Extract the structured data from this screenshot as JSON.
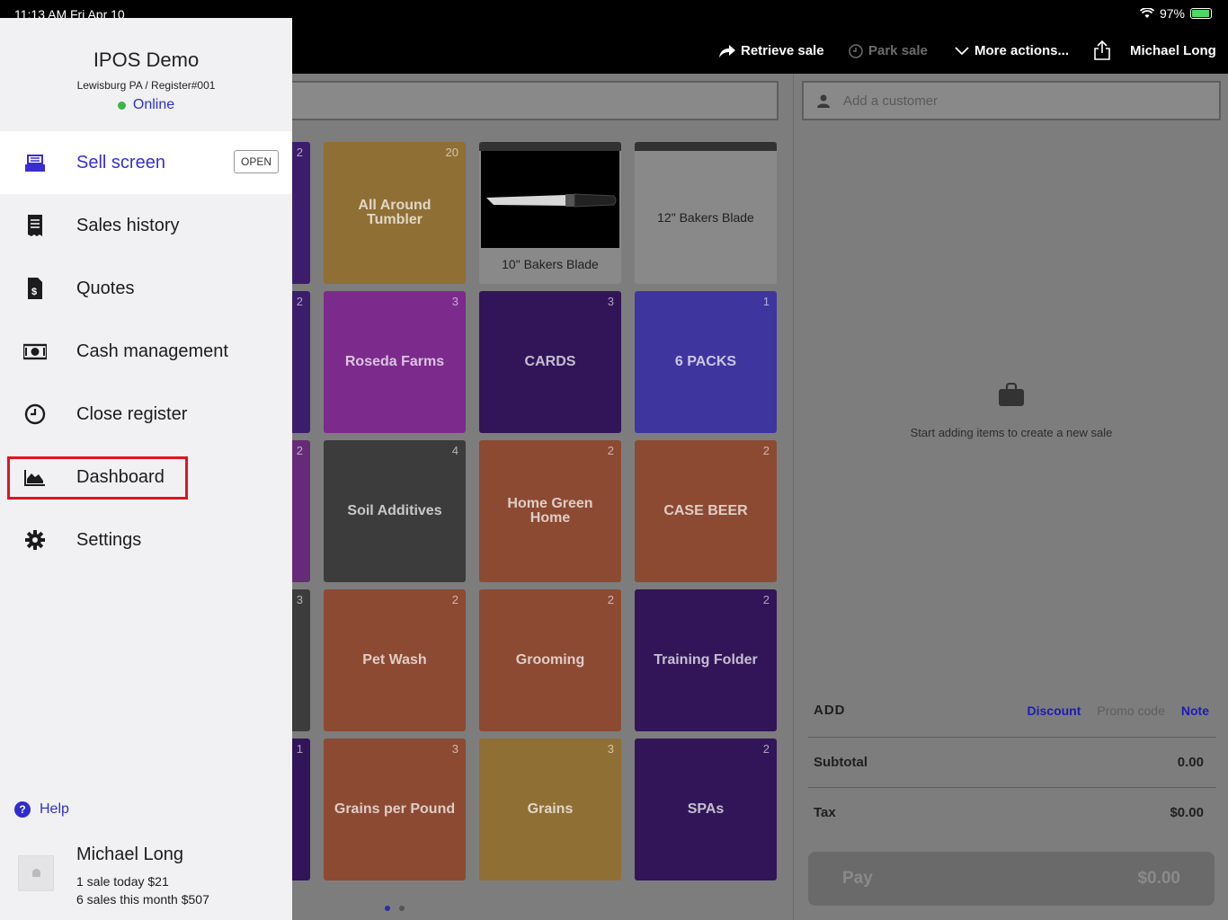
{
  "status_bar": {
    "time": "11:13 AM  Fri Apr 10",
    "battery": "97%"
  },
  "top_actions": {
    "retrieve_sale": "Retrieve sale",
    "park_sale": "Park sale",
    "more_actions": "More actions...",
    "user": "Michael Long"
  },
  "tiles": [
    {
      "label": "All Around Tumbler",
      "count": "20",
      "color": "#906f35"
    },
    {
      "label": "10\" Bakers Blade",
      "count": "",
      "color": "#898989"
    },
    {
      "label": "12\" Bakers Blade",
      "count": "",
      "color": "#898989"
    },
    {
      "label": "Roseda Farms",
      "count": "3",
      "color": "#7c2b8d"
    },
    {
      "label": "CARDS",
      "count": "3",
      "color": "#311558"
    },
    {
      "label": "6 PACKS",
      "count": "1",
      "color": "#3f359e"
    },
    {
      "label": "Soil Additives",
      "count": "4",
      "color": "#3c3c3c"
    },
    {
      "label": "Home Green Home",
      "count": "2",
      "color": "#8c4a33"
    },
    {
      "label": "CASE BEER",
      "count": "2",
      "color": "#8c4a33"
    },
    {
      "label": "Pet Wash",
      "count": "2",
      "color": "#8c4a33"
    },
    {
      "label": "Grooming",
      "count": "2",
      "color": "#8c4a33"
    },
    {
      "label": "Training Folder",
      "count": "2",
      "color": "#311558"
    },
    {
      "label": "Grains per Pound",
      "count": "3",
      "color": "#8c4a33"
    },
    {
      "label": "Grains",
      "count": "3",
      "color": "#906f35"
    },
    {
      "label": "SPAs",
      "count": "2",
      "color": "#311558"
    }
  ],
  "partial_tiles": [
    {
      "count": "2",
      "color": "#3c1d6b"
    },
    {
      "count": "2",
      "color": "#3c1d6b"
    },
    {
      "count": "2",
      "color": "#652b78"
    },
    {
      "count": "3",
      "color": "#3c3c3c"
    },
    {
      "count": "1",
      "color": "#311558"
    }
  ],
  "sale": {
    "customer_placeholder": "Add a customer",
    "empty_message": "Start adding items to create a new sale",
    "add_label": "ADD",
    "discount": "Discount",
    "promo_code": "Promo code",
    "note": "Note",
    "subtotal_label": "Subtotal",
    "subtotal_value": "0.00",
    "tax_label": "Tax",
    "tax_value": "$0.00",
    "pay_label": "Pay",
    "pay_value": "$0.00"
  },
  "drawer": {
    "store_name": "IPOS Demo",
    "location": "Lewisburg PA / Register#001",
    "status": "Online",
    "nav": [
      {
        "label": "Sell screen",
        "badge": "OPEN",
        "active": true
      },
      {
        "label": "Sales history"
      },
      {
        "label": "Quotes"
      },
      {
        "label": "Cash management"
      },
      {
        "label": "Close register"
      },
      {
        "label": "Dashboard",
        "highlighted": true
      },
      {
        "label": "Settings"
      }
    ],
    "help": "Help",
    "user_name": "Michael Long",
    "stat_today": "1 sale today $21",
    "stat_month": "6 sales this month $507"
  }
}
